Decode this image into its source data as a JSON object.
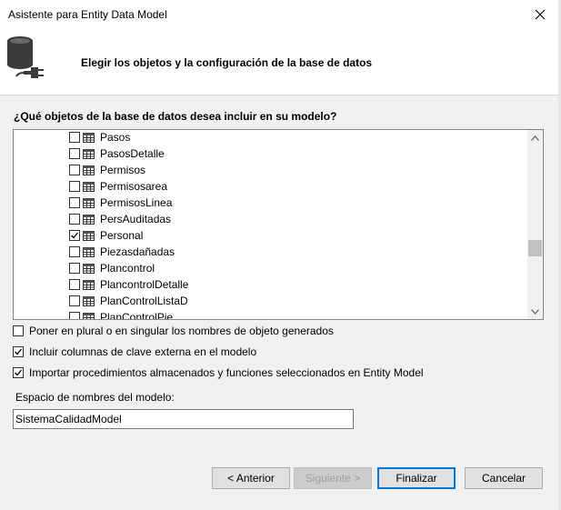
{
  "window": {
    "title": "Asistente para Entity Data Model"
  },
  "header": {
    "text": "Elegir los objetos y la configuración de la base de datos"
  },
  "question": "¿Qué objetos de la base de datos desea incluir en su modelo?",
  "tree_items": [
    {
      "label": "Pasos",
      "checked": false
    },
    {
      "label": "PasosDetalle",
      "checked": false
    },
    {
      "label": "Permisos",
      "checked": false
    },
    {
      "label": "Permisosarea",
      "checked": false
    },
    {
      "label": "PermisosLinea",
      "checked": false
    },
    {
      "label": "PersAuditadas",
      "checked": false
    },
    {
      "label": "Personal",
      "checked": true
    },
    {
      "label": "Piezasdañadas",
      "checked": false
    },
    {
      "label": "Plancontrol",
      "checked": false
    },
    {
      "label": "PlancontrolDetalle",
      "checked": false
    },
    {
      "label": "PlanControlListaD",
      "checked": false
    },
    {
      "label": "PlanControlPie",
      "checked": false
    }
  ],
  "options": [
    {
      "label": "Poner en plural o en singular los nombres de objeto generados",
      "checked": false
    },
    {
      "label": "Incluir columnas de clave externa en el modelo",
      "checked": true
    },
    {
      "label": "Importar procedimientos almacenados y funciones seleccionados en Entity Model",
      "checked": true
    }
  ],
  "namespace": {
    "label": "Espacio de nombres del modelo:",
    "value": "SistemaCalidadModel"
  },
  "buttons": {
    "back": "< Anterior",
    "next": "Siguiente >",
    "finish": "Finalizar",
    "cancel": "Cancelar"
  }
}
